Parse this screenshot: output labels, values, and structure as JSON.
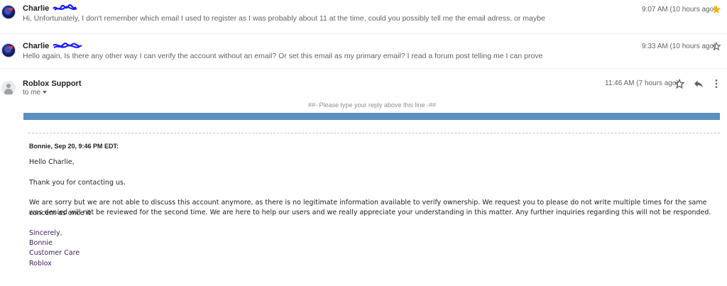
{
  "messages": [
    {
      "sender": "Charlie",
      "snippet": "Hi, Unfortunately, I don't remember which email I used to register as I was probably about 11 at the time, could you possibly tell me the email adress, or maybe",
      "time": "9:07 AM (10 hours ago)",
      "starred": true
    },
    {
      "sender": "Charlie",
      "snippet": "Hello again, Is there any other way I can verify the account without an email? Or set this email as my primary email? I read a forum post telling me I can prove",
      "time": "9:33 AM (10 hours ago)",
      "starred": false
    }
  ],
  "open_message": {
    "sender": "Roblox Support",
    "recipient": "to me",
    "time": "11:46 AM (7 hours ago)",
    "reply_marker": "##- Please type your reply above this line -##",
    "quote_header": "Bonnie, Sep 20, 9:46 PM EDT:",
    "greeting": "Hello Charlie,",
    "thanks": "Thank you for contacting us.",
    "paragraph_line1": "We are sorry but we are not able to discuss this account anymore, as there is no legitimate information available to verify ownership. We request you to please do not write multiple times for the same concern as once it",
    "paragraph_line2": "was denied will not be reviewed for the second time. We are here to help our users and we really appreciate your understanding in this matter. Any further inquiries regarding this will not be responded.",
    "signature": [
      "Sincerely,",
      "Bonnie",
      "Customer Care",
      "Roblox"
    ]
  },
  "colors": {
    "star_active": "#f4b400",
    "banner": "#5b8fbf",
    "signature_text": "#3d1e5c",
    "redaction_scribble": "#1a1aff"
  },
  "icons": [
    "star-icon",
    "reply-icon",
    "more-vert-icon",
    "caret-down-icon",
    "avatar-icon"
  ]
}
